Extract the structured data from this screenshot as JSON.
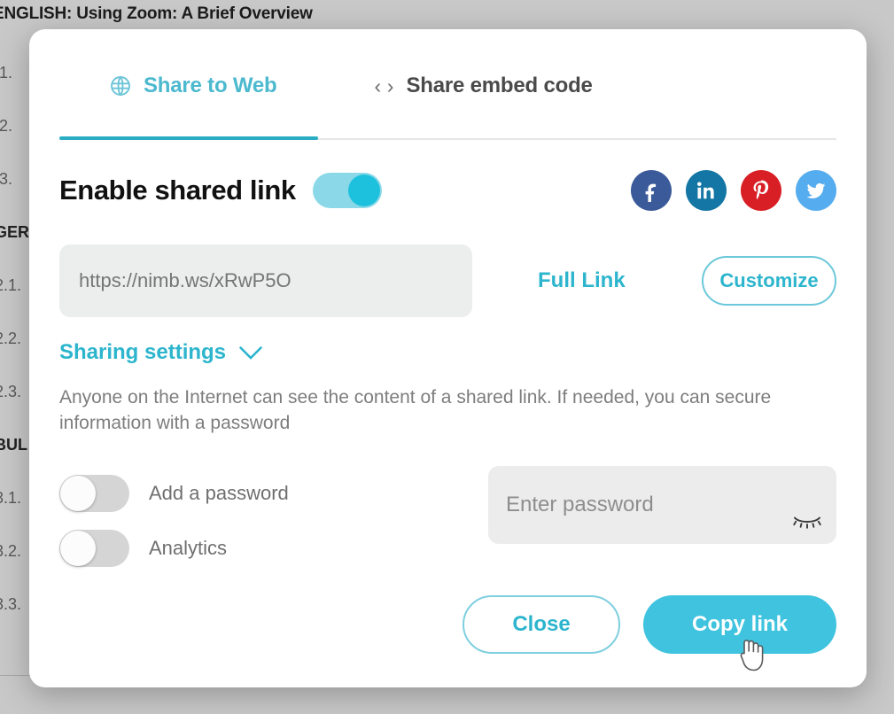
{
  "background": {
    "document_title": "ENGLISH: Using Zoom: A Brief Overview",
    "outline_items": [
      {
        "label": ".1.",
        "heading": false
      },
      {
        "label": ".2.",
        "heading": false
      },
      {
        "label": ".3.",
        "heading": false
      },
      {
        "label": "GER",
        "heading": true
      },
      {
        "label": "2.1.",
        "heading": false
      },
      {
        "label": "2.2.",
        "heading": false
      },
      {
        "label": "2.3.",
        "heading": false
      },
      {
        "label": "BUL",
        "heading": true
      },
      {
        "label": "3.1.",
        "heading": false
      },
      {
        "label": "3.2.",
        "heading": false
      },
      {
        "label": "3.3.",
        "heading": false
      }
    ]
  },
  "dialog": {
    "tabs": [
      {
        "label": "Share to Web",
        "icon": "globe-icon",
        "active": true
      },
      {
        "label": "Share embed code",
        "icon": "code-brackets-icon",
        "active": false
      }
    ],
    "enable_shared_link": {
      "label": "Enable shared link",
      "toggle_state": "on"
    },
    "social_buttons": [
      {
        "name": "facebook",
        "label": "f",
        "color": "#3b5a9a"
      },
      {
        "name": "linkedin",
        "label": "in",
        "color": "#1476a4"
      },
      {
        "name": "pinterest",
        "label": "P",
        "color": "#d81f26"
      },
      {
        "name": "twitter",
        "label": "bird",
        "color": "#55acee"
      }
    ],
    "link": {
      "value": "https://nimb.ws/xRwP5O",
      "placeholder": "https://nimb.ws/xRwP5O",
      "full_link_label": "Full Link",
      "customize_label": "Customize"
    },
    "sharing_settings": {
      "label": "Sharing settings",
      "chevron": "chevron-down-icon",
      "description": "Anyone on the Internet can see the content of a shared link. If needed, you can secure information with a password"
    },
    "options": [
      {
        "label": "Add a password",
        "toggle_state": "off"
      },
      {
        "label": "Analytics",
        "toggle_state": "off"
      }
    ],
    "password": {
      "value": "",
      "placeholder": "Enter password",
      "visibility_icon": "eye-off-icon"
    },
    "footer": {
      "close_label": "Close",
      "copy_label": "Copy link"
    }
  },
  "colors": {
    "accent": "#2cb5cd",
    "accent_fill": "#3fc3de",
    "toggle_on_track": "#8ad8e8",
    "toggle_on_knob": "#1ec1dd",
    "toggle_off_track": "#d5d5d5",
    "muted_text": "#7d7d7d"
  }
}
